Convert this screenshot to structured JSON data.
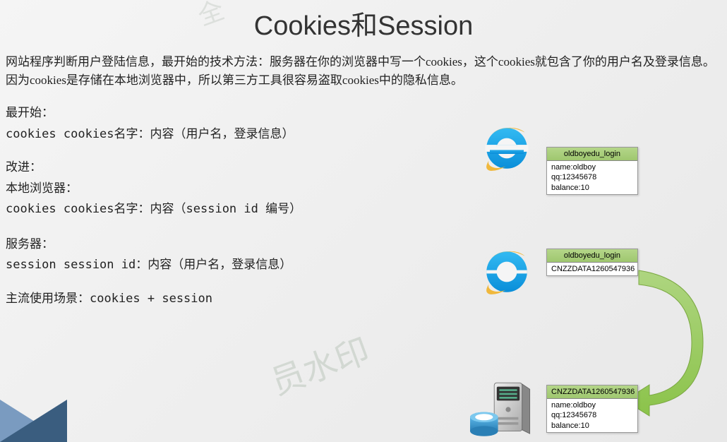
{
  "title": "Cookies和Session",
  "intro": "网站程序判断用户登陆信息，最开始的技术方法：服务器在你的浏览器中写一个cookies，这个cookies就包含了你的用户名及登录信息。因为cookies是存储在本地浏览器中，所以第三方工具很容易盗取cookies中的隐私信息。",
  "section1": {
    "heading": "最开始：",
    "line": "cookies   cookies名字：内容（用户名，登录信息）"
  },
  "section2": {
    "heading": "改进：",
    "sub1": "本地浏览器：",
    "line1": "cookies   cookies名字：内容（session id 编号）",
    "sub2": "服务器：",
    "line2": "session   session id：内容（用户名，登录信息）"
  },
  "section3": {
    "line": "主流使用场景：cookies + session"
  },
  "box1": {
    "title": "oldboyedu_login",
    "l1": "name:oldboy",
    "l2": "qq:12345678",
    "l3": "balance:10"
  },
  "box2": {
    "title": "oldboyedu_login",
    "l1": "CNZZDATA1260547936"
  },
  "box3": {
    "title": "CNZZDATA1260547936",
    "l1": "name:oldboy",
    "l2": "qq:12345678",
    "l3": "balance:10"
  },
  "watermark": "员水印",
  "watermark2": "全"
}
